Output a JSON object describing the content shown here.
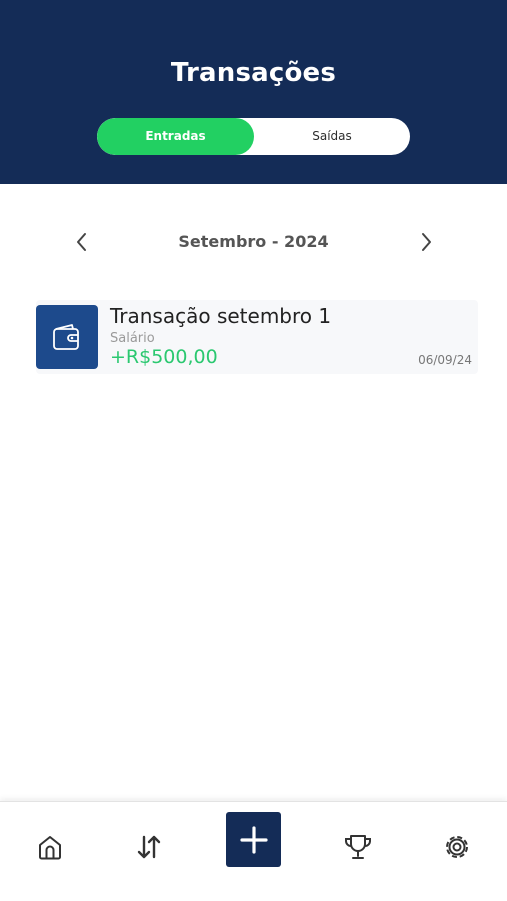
{
  "header": {
    "title": "Transações"
  },
  "tabs": {
    "active_label": "Entradas",
    "inactive_label": "Saídas"
  },
  "month_nav": {
    "label": "Setembro - 2024",
    "prev_icon": "chevron-left-icon",
    "next_icon": "chevron-right-icon"
  },
  "transactions": [
    {
      "title": "Transação setembro 1",
      "category": "Salário",
      "amount": "+R$500,00",
      "date": "06/09/24",
      "icon": "wallet-icon"
    }
  ],
  "bottom_nav": {
    "items": [
      "home-icon",
      "transfer-arrows-icon",
      "plus-icon",
      "trophy-icon",
      "gear-icon"
    ]
  },
  "colors": {
    "header_bg": "#142c57",
    "active_tab": "#22d062",
    "income_amount": "#2bc870",
    "icon_box": "#1d4a8c"
  }
}
